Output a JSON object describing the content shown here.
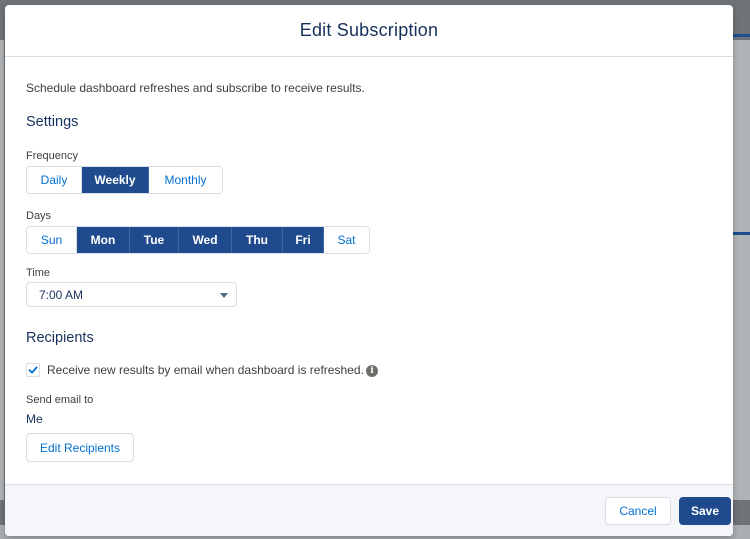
{
  "dialog": {
    "title": "Edit Subscription",
    "description": "Schedule dashboard refreshes and subscribe to receive results."
  },
  "settings": {
    "heading": "Settings",
    "frequency": {
      "label": "Frequency",
      "options": [
        "Daily",
        "Weekly",
        "Monthly"
      ],
      "selected": "Weekly"
    },
    "days": {
      "label": "Days",
      "options": [
        "Sun",
        "Mon",
        "Tue",
        "Wed",
        "Thu",
        "Fri",
        "Sat"
      ],
      "selected": [
        "Mon",
        "Tue",
        "Wed",
        "Thu",
        "Fri"
      ]
    },
    "time": {
      "label": "Time",
      "value": "7:00 AM"
    }
  },
  "recipients": {
    "heading": "Recipients",
    "email_checkbox_label": "Receive new results by email when dashboard is refreshed.",
    "email_checked": true,
    "send_email_label": "Send email to",
    "send_email_value": "Me",
    "edit_button": "Edit Recipients"
  },
  "footer": {
    "cancel": "Cancel",
    "save": "Save"
  },
  "colors": {
    "brand": "#1f4b8e",
    "link": "#0070d2",
    "text": "#16325c"
  }
}
